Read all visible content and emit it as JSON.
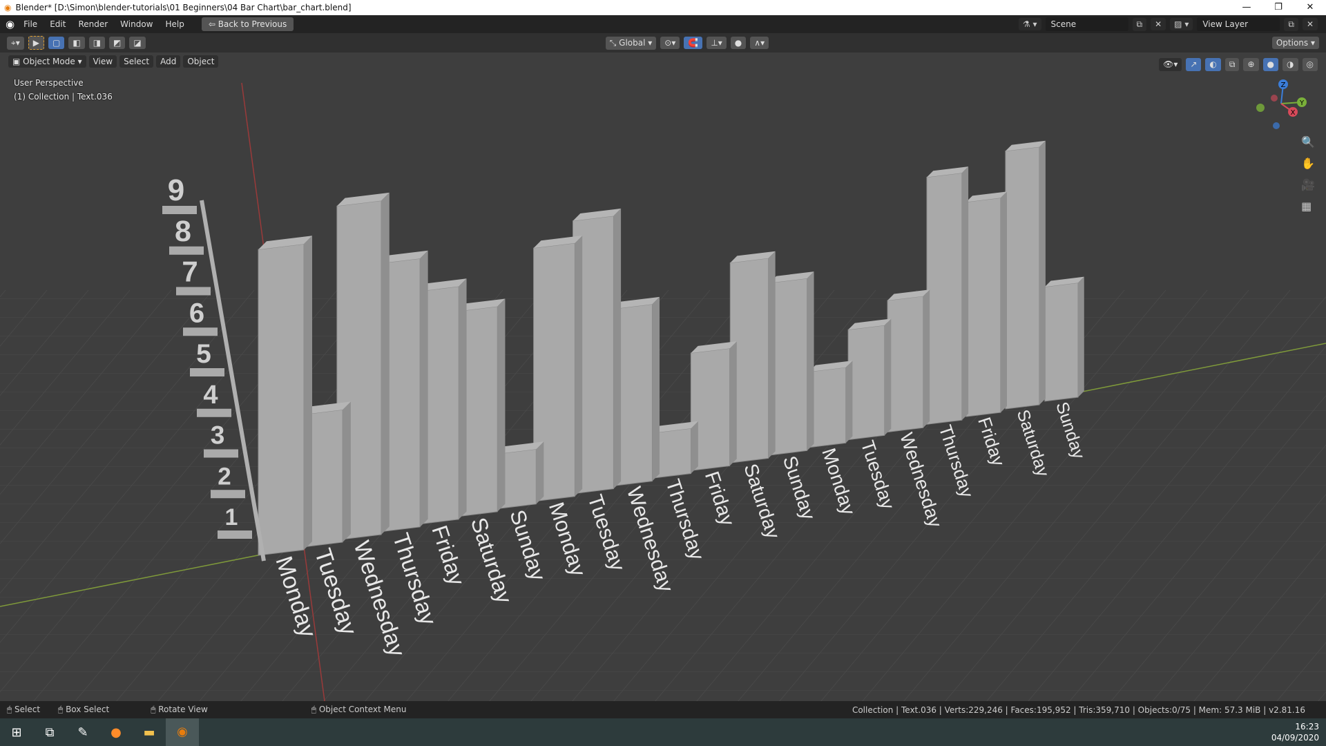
{
  "window": {
    "title": "Blender* [D:\\Simon\\blender-tutorials\\01 Beginners\\04 Bar Chart\\bar_chart.blend]",
    "minimize": "—",
    "restore": "❐",
    "close": "✕"
  },
  "menu": {
    "items": [
      "File",
      "Edit",
      "Render",
      "Window",
      "Help"
    ],
    "back_button": "Back to Previous"
  },
  "scene": {
    "scene_name": "Scene",
    "view_layer": "View Layer"
  },
  "toolheader": {
    "orientation": "Global",
    "options": "Options"
  },
  "viewport_header": {
    "mode": "Object Mode",
    "menus": [
      "View",
      "Select",
      "Add",
      "Object"
    ]
  },
  "overlay": {
    "perspective": "User Perspective",
    "collection": "(1) Collection | Text.036"
  },
  "chart_scene": {
    "axis_labels": [
      "1",
      "2",
      "3",
      "4",
      "5",
      "6",
      "7",
      "8",
      "9"
    ],
    "day_labels": [
      "Monday",
      "Tuesday",
      "Wednesday",
      "Thursday",
      "Friday",
      "Saturday",
      "Sunday",
      "Monday",
      "Tuesday",
      "Wednesday",
      "Thursday",
      "Friday",
      "Saturday",
      "Sunday",
      "Monday",
      "Tuesday",
      "Wednesday",
      "Thursday",
      "Friday",
      "Saturday",
      "Sunday"
    ],
    "bar_color": "#b5b5b5"
  },
  "gizmo": {
    "x": "X",
    "y": "Y",
    "z": "Z"
  },
  "status": {
    "select": "Select",
    "box_select": "Box Select",
    "rotate": "Rotate View",
    "context": "Object Context Menu",
    "stats": "Collection | Text.036 | Verts:229,246 | Faces:195,952 | Tris:359,710 | Objects:0/75 | Mem: 57.3 MiB | v2.81.16"
  },
  "taskbar": {
    "time": "16:23",
    "date": "04/09/2020"
  }
}
